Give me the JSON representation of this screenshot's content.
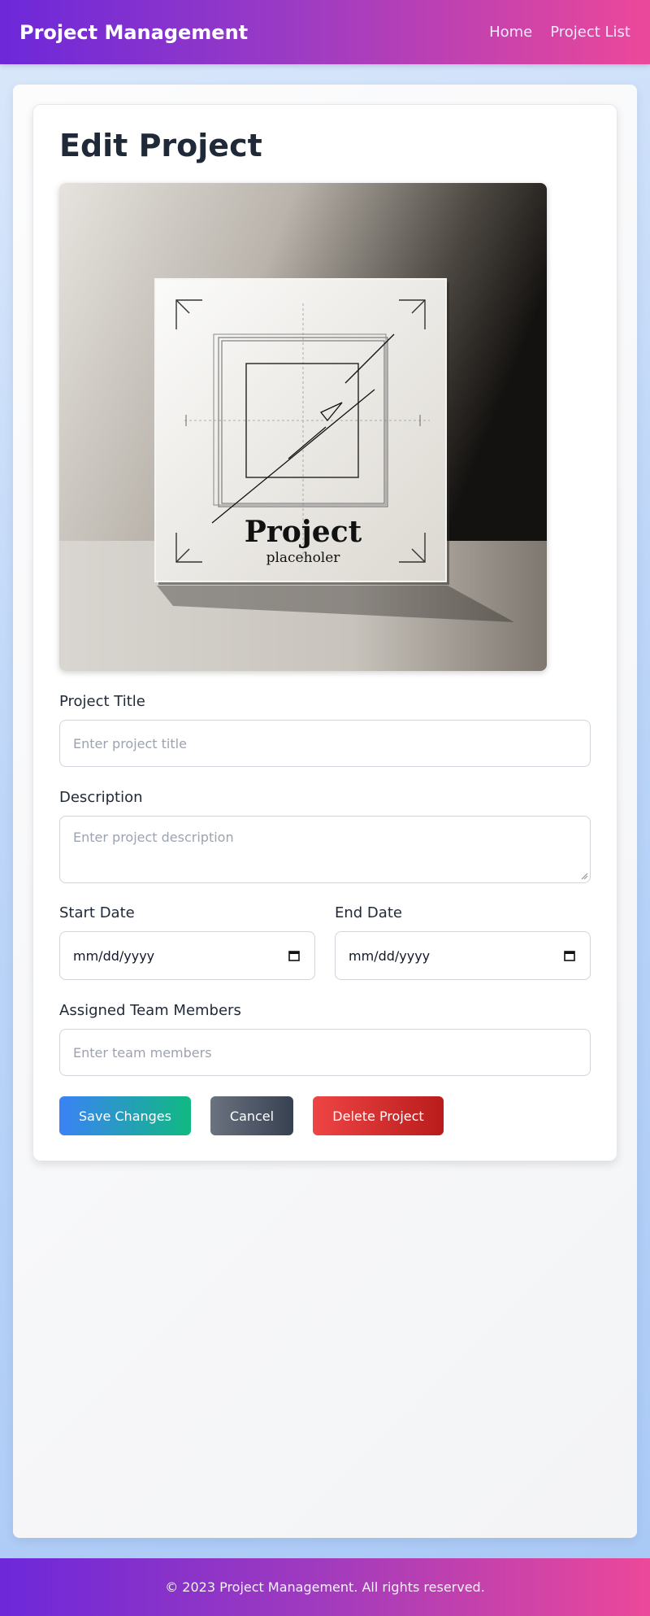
{
  "navbar": {
    "brand": "Project Management",
    "links": [
      "Home",
      "Project List"
    ]
  },
  "main": {
    "title": "Edit Project",
    "image": {
      "heading": "Project",
      "caption": "placeholer"
    },
    "form": {
      "title_label": "Project Title",
      "title_placeholder": "Enter project title",
      "description_label": "Description",
      "description_placeholder": "Enter project description",
      "start_label": "Start Date",
      "start_value": "mm/dd/yyyy",
      "end_label": "End Date",
      "end_value": "mm/dd/yyyy",
      "team_label": "Assigned Team Members",
      "team_placeholder": "Enter team members"
    },
    "buttons": {
      "save": "Save Changes",
      "cancel": "Cancel",
      "delete": "Delete Project"
    }
  },
  "footer": {
    "text": "© 2023 Project Management. All rights reserved."
  },
  "colors": {
    "nav_gradient_start": "#6d28d9",
    "nav_gradient_end": "#ec4899",
    "save_start": "#3b82f6",
    "save_end": "#10b981",
    "cancel_start": "#6b7280",
    "cancel_end": "#374151",
    "delete_start": "#ef4444",
    "delete_end": "#b91c1c"
  }
}
